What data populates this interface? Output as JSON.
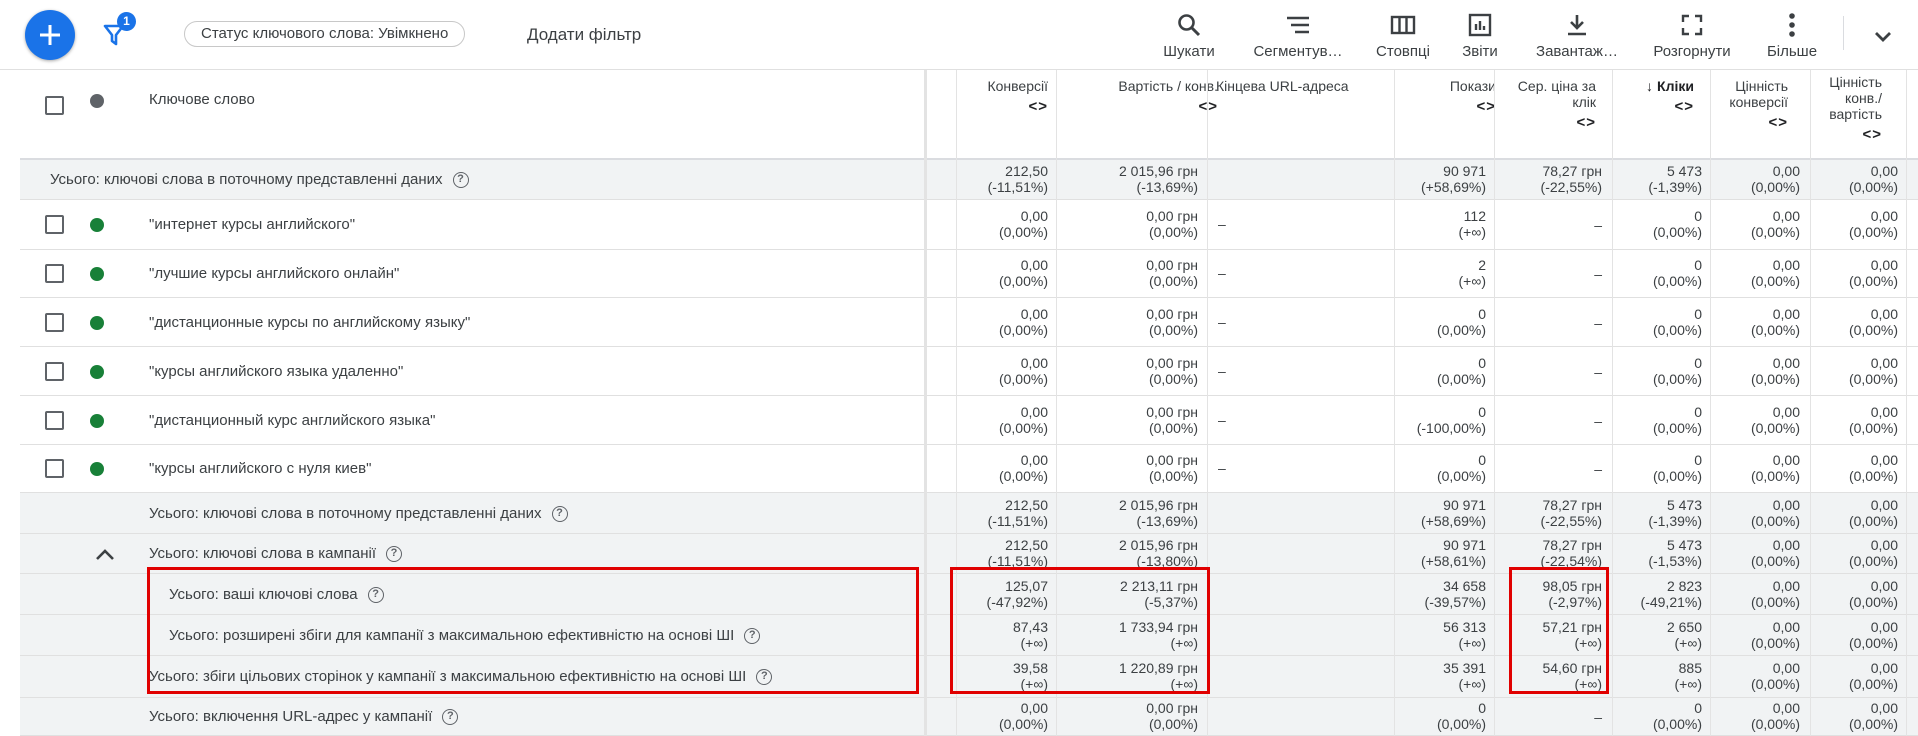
{
  "toolbar": {
    "filter_count": "1",
    "status_chip": "Статус ключового слова: Увімкнено",
    "add_filter": "Додати фільтр",
    "tools": [
      {
        "icon": "search-icon",
        "label": "Шукати"
      },
      {
        "icon": "segment-icon",
        "label": "Сегментув…"
      },
      {
        "icon": "columns-icon",
        "label": "Стовпці"
      },
      {
        "icon": "reports-icon",
        "label": "Звіти"
      },
      {
        "icon": "download-icon",
        "label": "Завантаж…"
      },
      {
        "icon": "expand-icon",
        "label": "Розгорнути"
      },
      {
        "icon": "more-icon",
        "label": "Більше"
      }
    ]
  },
  "table": {
    "headers": {
      "keyword": "Ключове слово",
      "conversions": "Конверсії",
      "cost_per_conv": "Вартість / конв.",
      "final_url": "Кінцева URL-адреса",
      "impressions": "Покази",
      "avg_cpc": "Сер. ціна за клік",
      "clicks": "Кліки",
      "conv_value": "Цінність конверсії",
      "conv_value_cost": "Цінність конв./ вартість",
      "sorter": "<>",
      "sort_arrow": "↓"
    },
    "rows": [
      {
        "kind": "total",
        "label": "Усього: ключові слова в поточному представленні даних",
        "conv": "212,50",
        "conv_d": "(-11,51%)",
        "cpc_conv": "2 015,96 грн",
        "cpc_conv_d": "(-13,69%)",
        "url": "",
        "impr": "90 971",
        "impr_d": "(+58,69%)",
        "acpc": "78,27 грн",
        "acpc_d": "(-22,55%)",
        "clicks": "5 473",
        "clicks_d": "(-1,39%)",
        "cv": "0,00",
        "cv_d": "(0,00%)",
        "cvc": "0,00",
        "cvc_d": "(0,00%)"
      },
      {
        "kind": "kw",
        "label": "\"интернет курсы английского\"",
        "conv": "0,00",
        "conv_d": "(0,00%)",
        "cpc_conv": "0,00 грн",
        "cpc_conv_d": "(0,00%)",
        "url": "–",
        "impr": "112",
        "impr_d": "(+∞)",
        "acpc": "–",
        "acpc_d": "",
        "clicks": "0",
        "clicks_d": "(0,00%)",
        "cv": "0,00",
        "cv_d": "(0,00%)",
        "cvc": "0,00",
        "cvc_d": "(0,00%)"
      },
      {
        "kind": "kw",
        "label": "\"лучшие курсы английского онлайн\"",
        "conv": "0,00",
        "conv_d": "(0,00%)",
        "cpc_conv": "0,00 грн",
        "cpc_conv_d": "(0,00%)",
        "url": "–",
        "impr": "2",
        "impr_d": "(+∞)",
        "acpc": "–",
        "acpc_d": "",
        "clicks": "0",
        "clicks_d": "(0,00%)",
        "cv": "0,00",
        "cv_d": "(0,00%)",
        "cvc": "0,00",
        "cvc_d": "(0,00%)"
      },
      {
        "kind": "kw",
        "label": "\"дистанционные курсы по английскому языку\"",
        "conv": "0,00",
        "conv_d": "(0,00%)",
        "cpc_conv": "0,00 грн",
        "cpc_conv_d": "(0,00%)",
        "url": "–",
        "impr": "0",
        "impr_d": "(0,00%)",
        "acpc": "–",
        "acpc_d": "",
        "clicks": "0",
        "clicks_d": "(0,00%)",
        "cv": "0,00",
        "cv_d": "(0,00%)",
        "cvc": "0,00",
        "cvc_d": "(0,00%)"
      },
      {
        "kind": "kw",
        "label": "\"курсы английского языка удаленно\"",
        "conv": "0,00",
        "conv_d": "(0,00%)",
        "cpc_conv": "0,00 грн",
        "cpc_conv_d": "(0,00%)",
        "url": "–",
        "impr": "0",
        "impr_d": "(0,00%)",
        "acpc": "–",
        "acpc_d": "",
        "clicks": "0",
        "clicks_d": "(0,00%)",
        "cv": "0,00",
        "cv_d": "(0,00%)",
        "cvc": "0,00",
        "cvc_d": "(0,00%)"
      },
      {
        "kind": "kw",
        "label": "\"дистанционный курс английского языка\"",
        "conv": "0,00",
        "conv_d": "(0,00%)",
        "cpc_conv": "0,00 грн",
        "cpc_conv_d": "(0,00%)",
        "url": "–",
        "impr": "0",
        "impr_d": "(-100,00%)",
        "acpc": "–",
        "acpc_d": "",
        "clicks": "0",
        "clicks_d": "(0,00%)",
        "cv": "0,00",
        "cv_d": "(0,00%)",
        "cvc": "0,00",
        "cvc_d": "(0,00%)"
      },
      {
        "kind": "kw",
        "label": "\"курсы английского с нуля киев\"",
        "conv": "0,00",
        "conv_d": "(0,00%)",
        "cpc_conv": "0,00 грн",
        "cpc_conv_d": "(0,00%)",
        "url": "–",
        "impr": "0",
        "impr_d": "(0,00%)",
        "acpc": "–",
        "acpc_d": "",
        "clicks": "0",
        "clicks_d": "(0,00%)",
        "cv": "0,00",
        "cv_d": "(0,00%)",
        "cvc": "0,00",
        "cvc_d": "(0,00%)"
      },
      {
        "kind": "total",
        "label": "Усього: ключові слова в поточному представленні даних",
        "conv": "212,50",
        "conv_d": "(-11,51%)",
        "cpc_conv": "2 015,96 грн",
        "cpc_conv_d": "(-13,69%)",
        "url": "",
        "impr": "90 971",
        "impr_d": "(+58,69%)",
        "acpc": "78,27 грн",
        "acpc_d": "(-22,55%)",
        "clicks": "5 473",
        "clicks_d": "(-1,39%)",
        "cv": "0,00",
        "cv_d": "(0,00%)",
        "cvc": "0,00",
        "cvc_d": "(0,00%)"
      },
      {
        "kind": "total",
        "label": "Усього: ключові слова в кампанії",
        "caret": true,
        "conv": "212,50",
        "conv_d": "(-11,51%)",
        "cpc_conv": "2 015,96 грн",
        "cpc_conv_d": "(-13,80%)",
        "url": "",
        "impr": "90 971",
        "impr_d": "(+58,61%)",
        "acpc": "78,27 грн",
        "acpc_d": "(-22,54%)",
        "clicks": "5 473",
        "clicks_d": "(-1,53%)",
        "cv": "0,00",
        "cv_d": "(0,00%)",
        "cvc": "0,00",
        "cvc_d": "(0,00%)"
      },
      {
        "kind": "sub",
        "label": "Усього: ваші ключові слова",
        "conv": "125,07",
        "conv_d": "(-47,92%)",
        "cpc_conv": "2 213,11 грн",
        "cpc_conv_d": "(-5,37%)",
        "url": "",
        "impr": "34 658",
        "impr_d": "(-39,57%)",
        "acpc": "98,05 грн",
        "acpc_d": "(-2,97%)",
        "clicks": "2 823",
        "clicks_d": "(-49,21%)",
        "cv": "0,00",
        "cv_d": "(0,00%)",
        "cvc": "0,00",
        "cvc_d": "(0,00%)"
      },
      {
        "kind": "sub",
        "label": "Усього: розширені збіги для кампанії з максимальною ефективністю на основі ШІ",
        "conv": "87,43",
        "conv_d": "(+∞)",
        "cpc_conv": "1 733,94 грн",
        "cpc_conv_d": "(+∞)",
        "url": "",
        "impr": "56 313",
        "impr_d": "(+∞)",
        "acpc": "57,21 грн",
        "acpc_d": "(+∞)",
        "clicks": "2 650",
        "clicks_d": "(+∞)",
        "cv": "0,00",
        "cv_d": "(0,00%)",
        "cvc": "0,00",
        "cvc_d": "(0,00%)"
      },
      {
        "kind": "sub2",
        "label": "Усього: збіги цільових сторінок у кампанії з максимальною ефективністю на основі ШІ",
        "conv": "39,58",
        "conv_d": "(+∞)",
        "cpc_conv": "1 220,89 грн",
        "cpc_conv_d": "(+∞)",
        "url": "",
        "impr": "35 391",
        "impr_d": "(+∞)",
        "acpc": "54,60 грн",
        "acpc_d": "(+∞)",
        "clicks": "885",
        "clicks_d": "(+∞)",
        "cv": "0,00",
        "cv_d": "(0,00%)",
        "cvc": "0,00",
        "cvc_d": "(0,00%)"
      },
      {
        "kind": "total",
        "label": "Усього: включення URL-адрес у кампанії",
        "conv": "0,00",
        "conv_d": "(0,00%)",
        "cpc_conv": "0,00 грн",
        "cpc_conv_d": "(0,00%)",
        "url": "",
        "impr": "0",
        "impr_d": "(0,00%)",
        "acpc": "–",
        "acpc_d": "",
        "clicks": "0",
        "clicks_d": "(0,00%)",
        "cv": "0,00",
        "cv_d": "(0,00%)",
        "cvc": "0,00",
        "cvc_d": "(0,00%)"
      }
    ]
  },
  "colors": {
    "accent": "#1a73e8",
    "status_green": "#188038",
    "highlight": "#e00000"
  }
}
